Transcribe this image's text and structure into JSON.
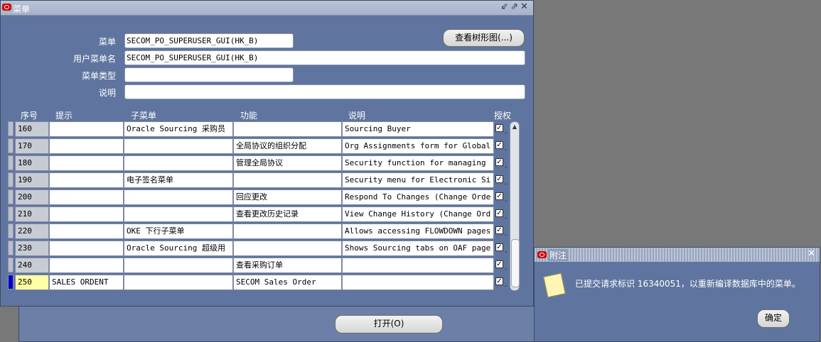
{
  "main_window": {
    "title": "菜单",
    "controls": [
      "minimize-icon",
      "maximize-icon",
      "close-icon"
    ]
  },
  "form": {
    "menu_label": "菜单",
    "menu_value": "SECOM_PO_SUPERUSER_GUI(HK_B)",
    "user_menu_name_label": "用户菜单名",
    "user_menu_name_value": "SECOM_PO_SUPERUSER_GUI(HK_B)",
    "menu_type_label": "菜单类型",
    "menu_type_value": "",
    "description_label": "说明",
    "description_value": "",
    "view_tree_button": "查看树形图(...)"
  },
  "table": {
    "headers": {
      "seq": "序号",
      "prompt": "提示",
      "submenu": "子菜单",
      "function": "功能",
      "description": "说明",
      "grant": "授权"
    },
    "rows": [
      {
        "seq": "160",
        "prompt": "",
        "submenu": "Oracle Sourcing 采购员",
        "function": "",
        "description": "Sourcing Buyer",
        "grant": "☑"
      },
      {
        "seq": "170",
        "prompt": "",
        "submenu": "",
        "function": "全局协议的组织分配",
        "description": "Org Assignments form for Global",
        "grant": "☑"
      },
      {
        "seq": "180",
        "prompt": "",
        "submenu": "",
        "function": "管理全局协议",
        "description": "Security function for managing",
        "grant": "☑"
      },
      {
        "seq": "190",
        "prompt": "",
        "submenu": "电子签名菜单",
        "function": "",
        "description": "Security menu for Electronic Si",
        "grant": "☑"
      },
      {
        "seq": "200",
        "prompt": "",
        "submenu": "",
        "function": "回应更改",
        "description": "Respond To Changes (Change Orde",
        "grant": "☑"
      },
      {
        "seq": "210",
        "prompt": "",
        "submenu": "",
        "function": "查看更改历史记录",
        "description": "View Change History (Change Ord",
        "grant": "☑"
      },
      {
        "seq": "220",
        "prompt": "",
        "submenu": "OKE 下行子菜单",
        "function": "",
        "description": "Allows accessing FLOWDOWN pages",
        "grant": "☑"
      },
      {
        "seq": "230",
        "prompt": "",
        "submenu": "Oracle Sourcing 超级用",
        "function": "",
        "description": "Shows Sourcing tabs on OAF page",
        "grant": "☑"
      },
      {
        "seq": "240",
        "prompt": "",
        "submenu": "",
        "function": "查看采购订单",
        "description": "",
        "grant": "☑"
      },
      {
        "seq": "250",
        "prompt": "SALES ORDENT",
        "submenu": "",
        "function": "SECOM Sales Order",
        "description": "",
        "grant": "☑"
      }
    ]
  },
  "open_button": "打开(O)",
  "notice": {
    "title": "附注",
    "message": "已提交请求标识 16340051，以重新编译数据库中的菜单。",
    "ok_button": "确定"
  }
}
